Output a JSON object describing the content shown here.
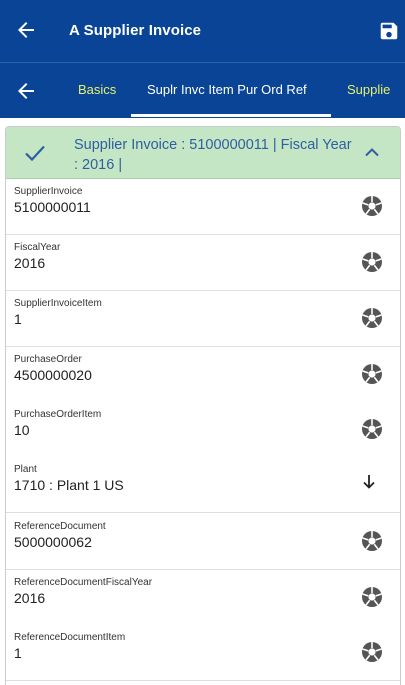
{
  "app_bar": {
    "title": "A Supplier Invoice",
    "back_icon": "arrow-left-icon",
    "save_icon": "save-icon"
  },
  "tabs": {
    "back_icon": "arrow-left-icon",
    "items": [
      {
        "label": "Basics"
      },
      {
        "label": "Suplr Invc Item Pur Ord Ref"
      },
      {
        "label": "Supplie"
      }
    ],
    "active_index": 1
  },
  "card": {
    "header_text": "Supplier Invoice : 5100000011 | Fiscal Year : 2016 |",
    "header_icon": "check-icon",
    "collapse_icon": "chevron-up-icon",
    "fields": [
      {
        "label": "SupplierInvoice",
        "value": "5100000011",
        "icon": "aperture-icon"
      },
      {
        "label": "FiscalYear",
        "value": "2016",
        "icon": "aperture-icon"
      },
      {
        "label": "SupplierInvoiceItem",
        "value": "1",
        "icon": "aperture-icon"
      },
      {
        "label": "PurchaseOrder",
        "value": "4500000020",
        "icon": "aperture-icon"
      },
      {
        "label": "PurchaseOrderItem",
        "value": "10",
        "icon": "aperture-icon"
      },
      {
        "label": "Plant",
        "value": "1710 : Plant 1 US",
        "icon": "arrow-down-icon"
      },
      {
        "label": "ReferenceDocument",
        "value": "5000000062",
        "icon": "aperture-icon"
      },
      {
        "label": "ReferenceDocumentFiscalYear",
        "value": "2016",
        "icon": "aperture-icon"
      },
      {
        "label": "ReferenceDocumentItem",
        "value": "1",
        "icon": "aperture-icon"
      }
    ]
  },
  "colors": {
    "header_blue": "#0a4496",
    "tab_accent": "#e6f06a",
    "card_header_green": "#c4e6c4",
    "card_header_text": "#2f5fa0"
  }
}
